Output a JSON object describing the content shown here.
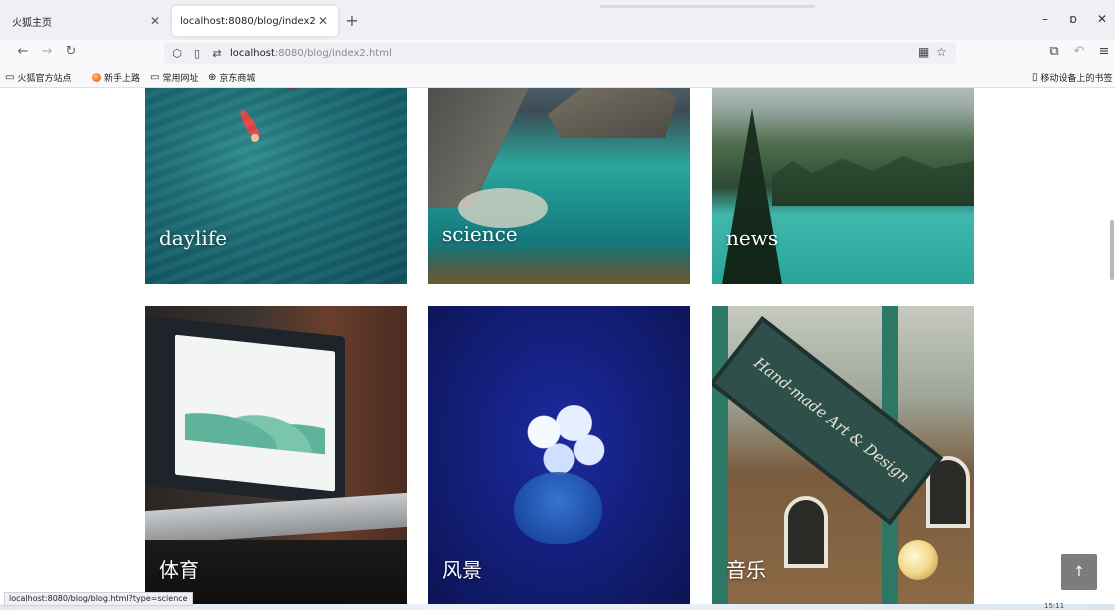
{
  "browser": {
    "tabs": [
      {
        "label": "火狐主页",
        "active": false
      },
      {
        "label": "localhost:8080/blog/index2.html",
        "active": true
      }
    ],
    "new_tab_icon": "plus-icon",
    "window_controls": {
      "minimize": "–",
      "restore": "ɒ",
      "close": "✕"
    },
    "url": {
      "host": "localhost",
      "path": ":8080/blog/index2.html"
    },
    "bookmarks": [
      {
        "label": "火狐官方站点",
        "icon": "folder-icon"
      },
      {
        "label": "新手上路",
        "icon": "firefox-icon"
      },
      {
        "label": "常用网址",
        "icon": "folder-icon"
      },
      {
        "label": "京东商城",
        "icon": "globe-icon"
      }
    ],
    "mobile_bookmarks": "移动设备上的书签"
  },
  "cards": [
    {
      "label": "daylife",
      "link": "daylife"
    },
    {
      "label": "science",
      "link": "science"
    },
    {
      "label": "news",
      "link": "news"
    },
    {
      "label": "体育",
      "link": "sports"
    },
    {
      "label": "风景",
      "link": "scenery"
    },
    {
      "label": "音乐",
      "link": "music"
    }
  ],
  "sign_text": "Hand-made Art & Design",
  "scroll_top_icon": "↑",
  "status_url": "localhost:8080/blog/blog.html?type=science",
  "clock": "15:11"
}
